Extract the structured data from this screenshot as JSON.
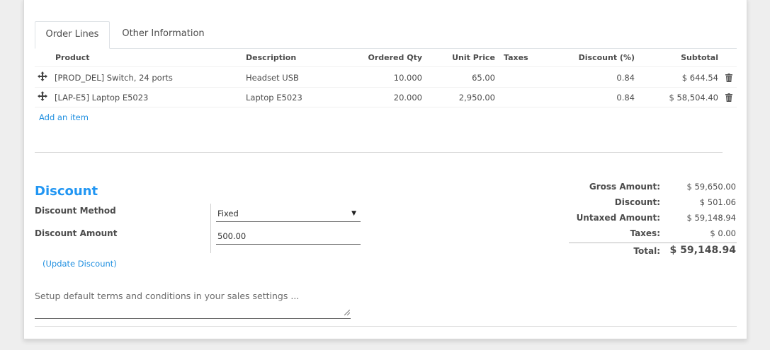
{
  "tabs": [
    {
      "label": "Order Lines",
      "active": true
    },
    {
      "label": "Other Information",
      "active": false
    }
  ],
  "table": {
    "headers": {
      "product": "Product",
      "description": "Description",
      "ordered_qty": "Ordered Qty",
      "unit_price": "Unit Price",
      "taxes": "Taxes",
      "discount": "Discount (%)",
      "subtotal": "Subtotal"
    },
    "rows": [
      {
        "product": "[PROD_DEL] Switch, 24 ports",
        "description": "Headset USB",
        "ordered_qty": "10.000",
        "unit_price": "65.00",
        "taxes": "",
        "discount": "0.84",
        "subtotal": "$ 644.54"
      },
      {
        "product": "[LAP-E5] Laptop E5023",
        "description": "Laptop E5023",
        "ordered_qty": "20.000",
        "unit_price": "2,950.00",
        "taxes": "",
        "discount": "0.84",
        "subtotal": "$ 58,504.40"
      }
    ],
    "add_item": "Add an item"
  },
  "discount": {
    "title": "Discount",
    "method_label": "Discount Method",
    "method_value": "Fixed",
    "amount_label": "Discount Amount",
    "amount_value": "500.00",
    "update_link": "(Update Discount)"
  },
  "totals": {
    "gross_label": "Gross Amount:",
    "gross_value": "$ 59,650.00",
    "discount_label": "Discount:",
    "discount_value": "$ 501.06",
    "untaxed_label": "Untaxed Amount:",
    "untaxed_value": "$ 59,148.94",
    "taxes_label": "Taxes:",
    "taxes_value": "$ 0.00",
    "total_label": "Total:",
    "total_value": "$ 59,148.94"
  },
  "notes": {
    "placeholder": "Setup default terms and conditions in your sales settings ..."
  },
  "colors": {
    "accent": "#2196f3",
    "link": "#1f8fe0"
  },
  "icons": {
    "drag": "drag-handle-icon",
    "delete": "trash-icon",
    "select": "caret-down-icon",
    "resize": "resize-grip-icon"
  }
}
